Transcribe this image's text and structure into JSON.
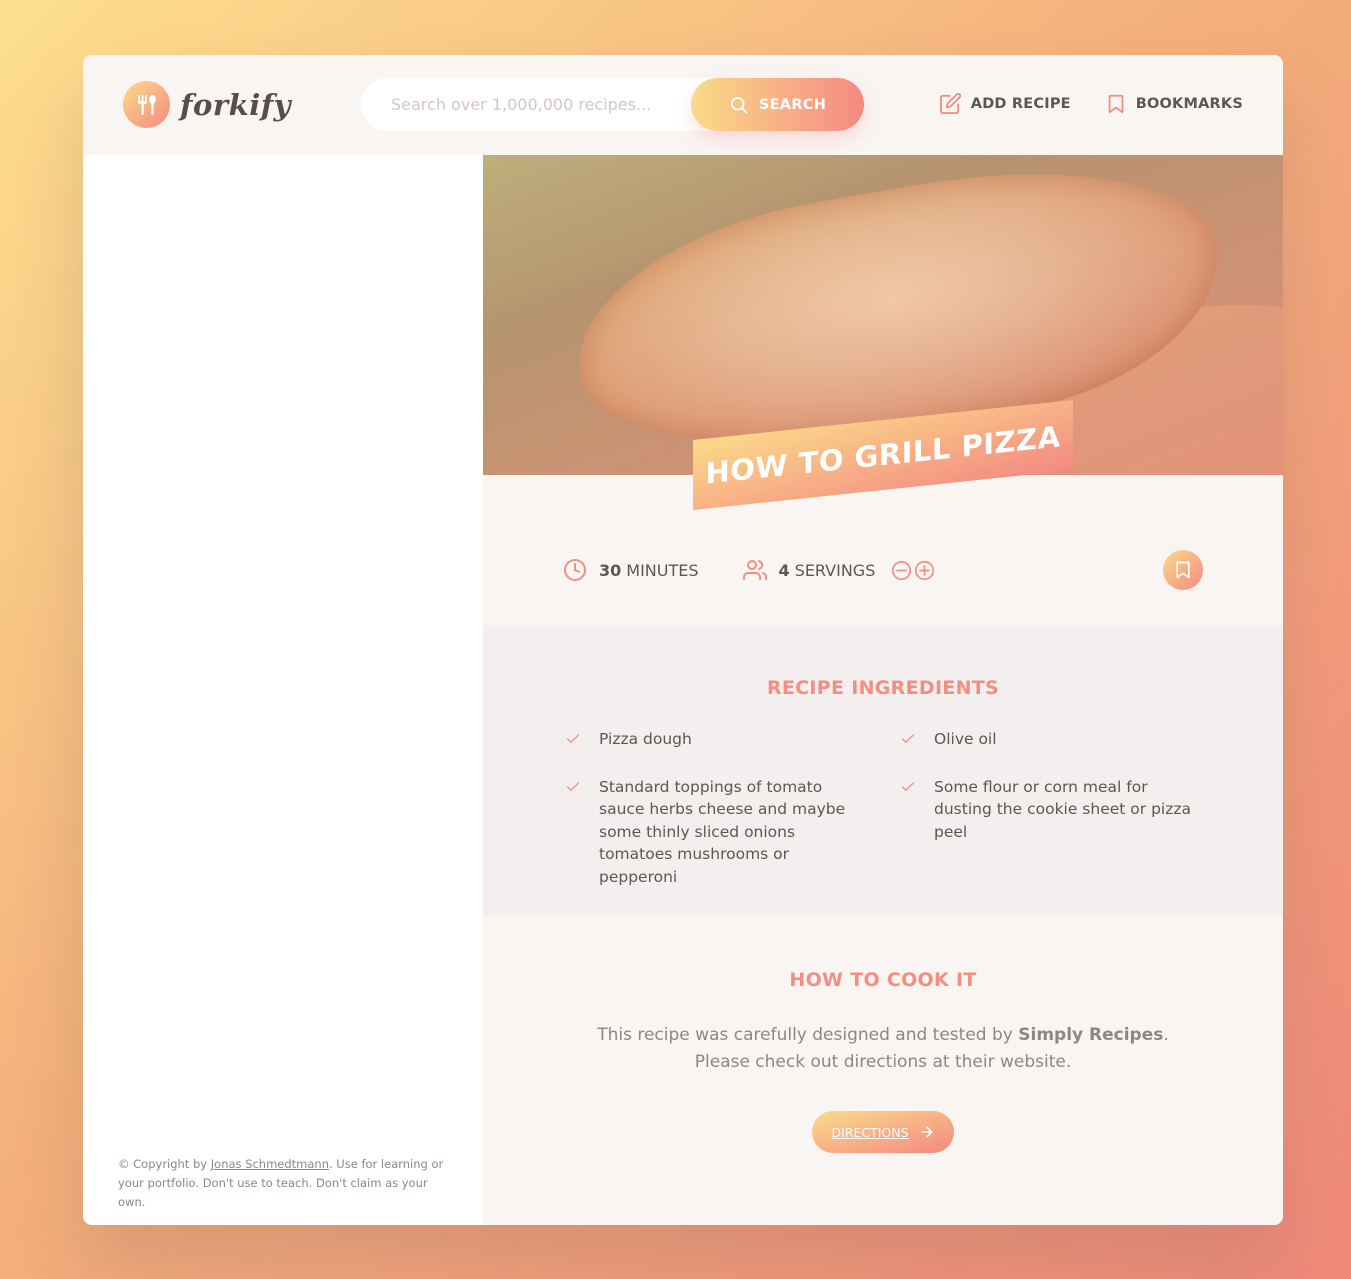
{
  "app": {
    "logo_text": "forkify"
  },
  "search": {
    "placeholder": "Search over 1,000,000 recipes...",
    "button_label": "Search"
  },
  "nav": {
    "add_recipe_label": "Add recipe",
    "bookmarks_label": "Bookmarks"
  },
  "recipe": {
    "title": "How to Grill Pizza",
    "cooking_time_value": "30",
    "cooking_time_unit": "minutes",
    "servings_value": "4",
    "servings_unit": "servings",
    "ingredients_heading": "Recipe ingredients",
    "ingredients": [
      "Pizza dough",
      "Olive oil",
      "Standard toppings of tomato sauce herbs cheese and maybe some thinly sliced onions tomatoes mushrooms or pepperoni",
      "Some flour or corn meal for dusting the cookie sheet or pizza peel"
    ],
    "cook_heading": "How to cook it",
    "cook_text_before": "This recipe was carefully designed and tested by ",
    "publisher": "Simply Recipes",
    "cook_text_after": ". Please check out directions at their website.",
    "directions_label": "Directions"
  },
  "footer": {
    "copyright_prefix": "© Copyright by ",
    "author": "Jonas Schmedtmann",
    "copyright_suffix": ". Use for learning or your portfolio. Don't use to teach. Don't claim as your own."
  },
  "colors": {
    "accent_light": "#fbdb89",
    "accent_dark": "#f48982",
    "text": "#615551",
    "muted": "#918581"
  }
}
